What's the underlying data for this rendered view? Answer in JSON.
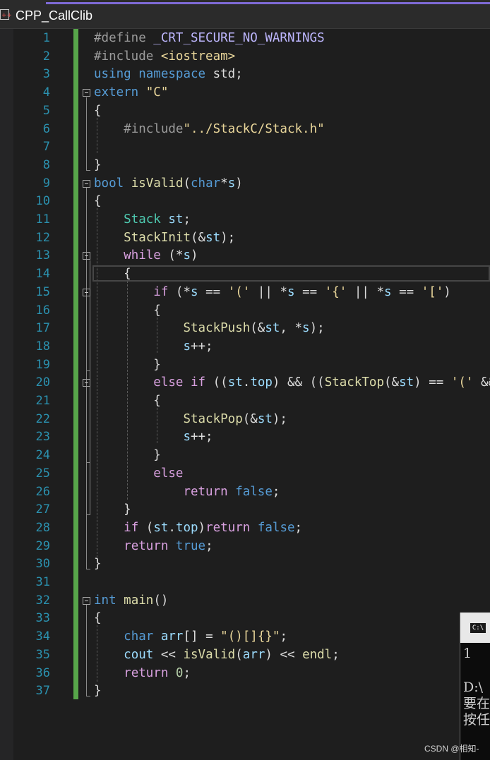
{
  "tab": {
    "title": "CPP_CallClib"
  },
  "colors": {
    "accent": "#7e6ad6",
    "change_bar": "#57a64a",
    "line_number": "#2b91af"
  },
  "editor": {
    "line_numbers": [
      "1",
      "2",
      "3",
      "4",
      "5",
      "6",
      "7",
      "8",
      "9",
      "10",
      "11",
      "12",
      "13",
      "14",
      "15",
      "16",
      "17",
      "18",
      "19",
      "20",
      "21",
      "22",
      "23",
      "24",
      "25",
      "26",
      "27",
      "28",
      "29",
      "30",
      "31",
      "32",
      "33",
      "34",
      "35",
      "36",
      "37"
    ],
    "current_line": "14",
    "lines": [
      [
        [
          "pp",
          "#define "
        ],
        [
          "mac",
          "_CRT_SECURE_NO_WARNINGS"
        ]
      ],
      [
        [
          "pp",
          "#include "
        ],
        [
          "str",
          "<iostream>"
        ]
      ],
      [
        [
          "kw",
          "using"
        ],
        [
          "par",
          " "
        ],
        [
          "kw",
          "namespace"
        ],
        [
          "par",
          " std;"
        ]
      ],
      [
        [
          "kw",
          "extern"
        ],
        [
          "par",
          " "
        ],
        [
          "str",
          "\"C\""
        ]
      ],
      [
        [
          "par",
          "{"
        ]
      ],
      [
        [
          "par",
          "    "
        ],
        [
          "pp",
          "#include"
        ],
        [
          "str",
          "\"../StackC/Stack.h\""
        ]
      ],
      [
        [
          "par",
          ""
        ]
      ],
      [
        [
          "par",
          "}"
        ]
      ],
      [
        [
          "kw",
          "bool"
        ],
        [
          "par",
          " "
        ],
        [
          "fn",
          "isValid"
        ],
        [
          "par",
          "("
        ],
        [
          "kw",
          "char"
        ],
        [
          "par",
          "*"
        ],
        [
          "var",
          "s"
        ],
        [
          "par",
          ")"
        ]
      ],
      [
        [
          "par",
          "{"
        ]
      ],
      [
        [
          "par",
          "    "
        ],
        [
          "ty",
          "Stack"
        ],
        [
          "par",
          " "
        ],
        [
          "var",
          "st"
        ],
        [
          "par",
          ";"
        ]
      ],
      [
        [
          "par",
          "    "
        ],
        [
          "fn",
          "StackInit"
        ],
        [
          "par",
          "(&"
        ],
        [
          "var",
          "st"
        ],
        [
          "par",
          ");"
        ]
      ],
      [
        [
          "par",
          "    "
        ],
        [
          "ctl",
          "while"
        ],
        [
          "par",
          " (*"
        ],
        [
          "var",
          "s"
        ],
        [
          "par",
          ")"
        ]
      ],
      [
        [
          "par",
          "    {"
        ]
      ],
      [
        [
          "par",
          "        "
        ],
        [
          "ctl",
          "if"
        ],
        [
          "par",
          " (*"
        ],
        [
          "var",
          "s"
        ],
        [
          "par",
          " == "
        ],
        [
          "str",
          "'('"
        ],
        [
          "par",
          " || *"
        ],
        [
          "var",
          "s"
        ],
        [
          "par",
          " == "
        ],
        [
          "str",
          "'{'"
        ],
        [
          "par",
          " || *"
        ],
        [
          "var",
          "s"
        ],
        [
          "par",
          " == "
        ],
        [
          "str",
          "'['"
        ],
        [
          "par",
          ")"
        ]
      ],
      [
        [
          "par",
          "        {"
        ]
      ],
      [
        [
          "par",
          "            "
        ],
        [
          "fn",
          "StackPush"
        ],
        [
          "par",
          "(&"
        ],
        [
          "var",
          "st"
        ],
        [
          "par",
          ", *"
        ],
        [
          "var",
          "s"
        ],
        [
          "par",
          ");"
        ]
      ],
      [
        [
          "par",
          "            "
        ],
        [
          "var",
          "s"
        ],
        [
          "par",
          "++;"
        ]
      ],
      [
        [
          "par",
          "        }"
        ]
      ],
      [
        [
          "par",
          "        "
        ],
        [
          "ctl",
          "else"
        ],
        [
          "par",
          " "
        ],
        [
          "ctl",
          "if"
        ],
        [
          "par",
          " (("
        ],
        [
          "var",
          "st"
        ],
        [
          "par",
          "."
        ],
        [
          "var",
          "top"
        ],
        [
          "par",
          ") && (("
        ],
        [
          "fn",
          "StackTop"
        ],
        [
          "par",
          "(&"
        ],
        [
          "var",
          "st"
        ],
        [
          "par",
          ") == "
        ],
        [
          "str",
          "'('"
        ],
        [
          "par",
          " &&"
        ]
      ],
      [
        [
          "par",
          "        {"
        ]
      ],
      [
        [
          "par",
          "            "
        ],
        [
          "fn",
          "StackPop"
        ],
        [
          "par",
          "(&"
        ],
        [
          "var",
          "st"
        ],
        [
          "par",
          ");"
        ]
      ],
      [
        [
          "par",
          "            "
        ],
        [
          "var",
          "s"
        ],
        [
          "par",
          "++;"
        ]
      ],
      [
        [
          "par",
          "        }"
        ]
      ],
      [
        [
          "par",
          "        "
        ],
        [
          "ctl",
          "else"
        ]
      ],
      [
        [
          "par",
          "            "
        ],
        [
          "ctl",
          "return"
        ],
        [
          "par",
          " "
        ],
        [
          "kw",
          "false"
        ],
        [
          "par",
          ";"
        ]
      ],
      [
        [
          "par",
          "    }"
        ]
      ],
      [
        [
          "par",
          "    "
        ],
        [
          "ctl",
          "if"
        ],
        [
          "par",
          " ("
        ],
        [
          "var",
          "st"
        ],
        [
          "par",
          "."
        ],
        [
          "var",
          "top"
        ],
        [
          "par",
          ")"
        ],
        [
          "ctl",
          "return"
        ],
        [
          "par",
          " "
        ],
        [
          "kw",
          "false"
        ],
        [
          "par",
          ";"
        ]
      ],
      [
        [
          "par",
          "    "
        ],
        [
          "ctl",
          "return"
        ],
        [
          "par",
          " "
        ],
        [
          "kw",
          "true"
        ],
        [
          "par",
          ";"
        ]
      ],
      [
        [
          "par",
          "}"
        ]
      ],
      [
        [
          "par",
          ""
        ]
      ],
      [
        [
          "kw",
          "int"
        ],
        [
          "par",
          " "
        ],
        [
          "fn",
          "main"
        ],
        [
          "par",
          "()"
        ]
      ],
      [
        [
          "par",
          "{"
        ]
      ],
      [
        [
          "par",
          "    "
        ],
        [
          "kw",
          "char"
        ],
        [
          "par",
          " "
        ],
        [
          "var",
          "arr"
        ],
        [
          "par",
          "[] = "
        ],
        [
          "str",
          "\"()[]{}\""
        ],
        [
          "par",
          ";"
        ]
      ],
      [
        [
          "par",
          "    "
        ],
        [
          "var",
          "cout"
        ],
        [
          "par",
          " << "
        ],
        [
          "fn",
          "isValid"
        ],
        [
          "par",
          "("
        ],
        [
          "var",
          "arr"
        ],
        [
          "par",
          ") << "
        ],
        [
          "fn",
          "endl"
        ],
        [
          "par",
          ";"
        ]
      ],
      [
        [
          "par",
          "    "
        ],
        [
          "ctl",
          "return"
        ],
        [
          "par",
          " "
        ],
        [
          "num",
          "0"
        ],
        [
          "par",
          ";"
        ]
      ],
      [
        [
          "par",
          "}"
        ]
      ]
    ],
    "fold_lines": [
      4,
      9,
      13,
      15,
      20,
      32
    ]
  },
  "console": {
    "icon_label": "C:\\",
    "lines": [
      "1",
      "",
      "D:\\",
      "要在",
      "按任"
    ]
  },
  "watermark": "CSDN @相知-"
}
